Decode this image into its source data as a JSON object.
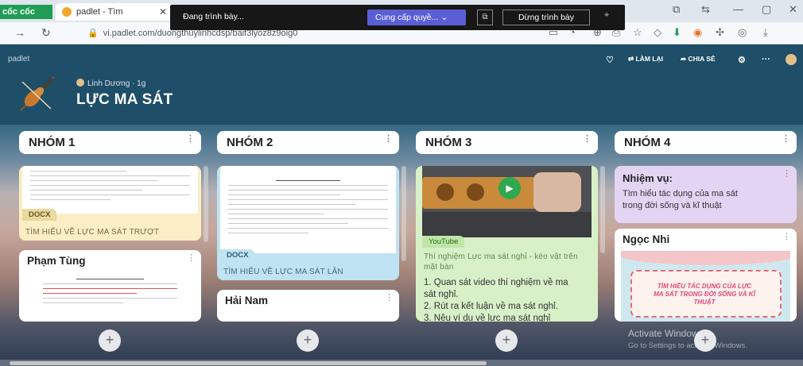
{
  "browser": {
    "brand": "cốc cốc",
    "tab_title": "padlet - Tìm",
    "tab_close": "✕",
    "url": "vi.padlet.com/duongthuylinhcdsp/baif3lyoz8z9oig0",
    "window_controls": [
      "⧉",
      "⇆",
      "—",
      "▢",
      "✕"
    ]
  },
  "presentation_bar": {
    "status": "Đang trình bày...",
    "provide_access": "Cung cấp quyề... ⌄",
    "stop": "Dừng trình bày"
  },
  "padlet": {
    "logo": "padlet",
    "toolbar": {
      "remake": "LÀM LẠI",
      "share": "CHIA SẺ"
    },
    "author": "Linh Dương",
    "age": "· 1g",
    "title": "LỰC MA SÁT",
    "columns": [
      {
        "title": "NHÓM 1",
        "cards": [
          {
            "badge": "DOCX",
            "caption": "TÌM HIỂU VỀ LỰC MA SÁT TRƯỢT"
          },
          {
            "name": "Phạm Tùng"
          }
        ]
      },
      {
        "title": "NHÓM 2",
        "cards": [
          {
            "badge": "DOCX",
            "caption": "TÌM HIỂU VỀ LỰC MA SÁT LĂN"
          },
          {
            "name": "Hải Nam"
          }
        ]
      },
      {
        "title": "NHÓM 3",
        "cards": [
          {
            "badge": "YouTube",
            "caption": "Thí nghiệm Lực ma sát nghỉ - kéo vật trên mặt bàn",
            "lines": [
              "1. Quan sát video thí nghiệm về ma",
              "sát nghỉ.",
              "2. Rút ra kết luận về ma sát nghỉ.",
              "3. Nêu ví dụ về lực ma sát nghỉ"
            ]
          }
        ]
      },
      {
        "title": "NHÓM 4",
        "cards": [
          {
            "name": "Nhiệm vụ:",
            "lines": [
              "Tìm hiểu tác dụng của ma sát",
              "trong đời sống và kĩ thuật"
            ]
          },
          {
            "name": "Ngọc Nhi",
            "image_text": "TÌM HIỂU TÁC DỤNG CỦA LỰC MA SÁT TRONG ĐỜI SỐNG VÀ KĨ THUẬT"
          }
        ]
      }
    ],
    "add_symbol": "+"
  },
  "watermark": {
    "title": "Activate Windows",
    "subtitle": "Go to Settings to activate Windows."
  },
  "colors": {
    "brand_green": "#1f9d55",
    "header_blue": "#1e4e68",
    "card_yellow": "#fbeec6",
    "card_blue": "#bfe3f2",
    "card_green": "#d8f0c8",
    "card_purple": "#e4d4f4"
  }
}
